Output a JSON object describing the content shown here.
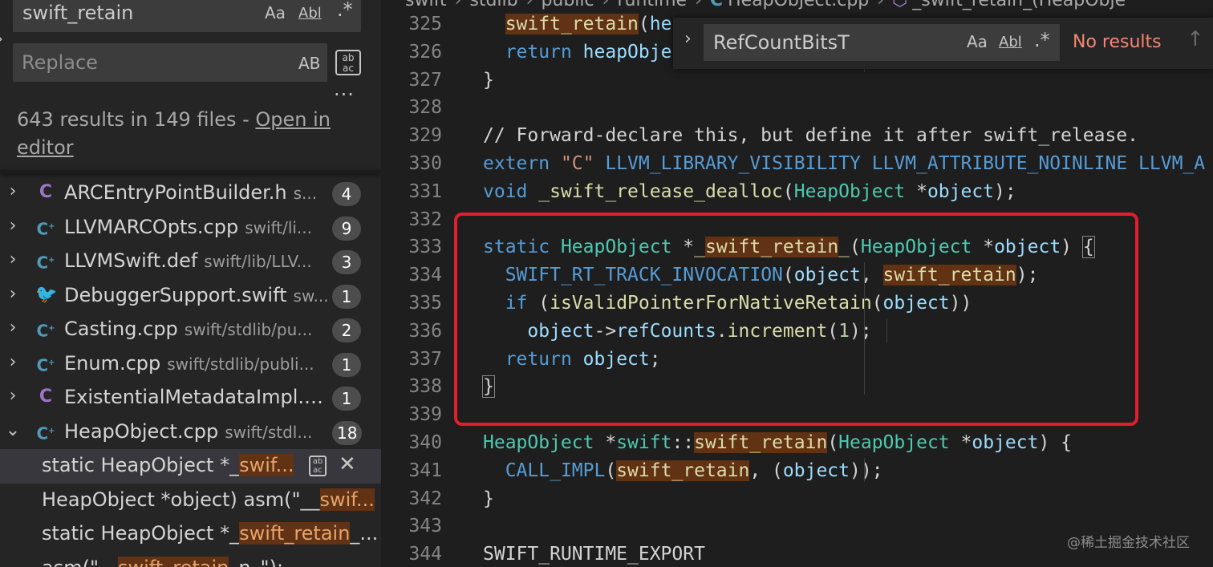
{
  "search": {
    "value": "swift_retain",
    "opt_case": "Aa",
    "opt_word": "Abl",
    "opt_regex": ".*"
  },
  "replace": {
    "placeholder": "Replace",
    "opt_preserve_case": "AB",
    "replace_all_label": "ab ac"
  },
  "results": {
    "summary": "643 results in 149 files - ",
    "open_in_editor": "Open in editor"
  },
  "files": [
    {
      "name": "ARCEntryPointBuilder.h",
      "path": "s...",
      "count": "4",
      "icon": "C",
      "icon_color": "#a074c4"
    },
    {
      "name": "LLVMARCOpts.cpp",
      "path": "swift/li...",
      "count": "9",
      "icon": "C+",
      "icon_color": "#519aba"
    },
    {
      "name": "LLVMSwift.def",
      "path": "swift/lib/LLV...",
      "count": "3",
      "icon": "C+",
      "icon_color": "#519aba"
    },
    {
      "name": "DebuggerSupport.swift",
      "path": "sw...",
      "count": "1",
      "icon": "swift",
      "icon_color": "#e37933"
    },
    {
      "name": "Casting.cpp",
      "path": "swift/stdlib/pu...",
      "count": "2",
      "icon": "C+",
      "icon_color": "#519aba"
    },
    {
      "name": "Enum.cpp",
      "path": "swift/stdlib/publi...",
      "count": "1",
      "icon": "C+",
      "icon_color": "#519aba"
    },
    {
      "name": "ExistentialMetadataImpl.h...",
      "path": "",
      "count": "1",
      "icon": "C",
      "icon_color": "#a074c4"
    },
    {
      "name": "HeapObject.cpp",
      "path": "swift/stdl...",
      "count": "18",
      "icon": "C+",
      "icon_color": "#519aba"
    }
  ],
  "matches": [
    {
      "pre": "static HeapObject *_",
      "hit": "swif...",
      "post": ""
    },
    {
      "pre": "HeapObject *object) asm(\"__",
      "hit": "swif...",
      "post": ""
    },
    {
      "pre": "static HeapObject *_",
      "hit": "swift_retain",
      "post": "_..."
    },
    {
      "pre": "asm(\"__",
      "hit": "swift_retain",
      "post": "_n_\");"
    }
  ],
  "breadcrumb": {
    "items": [
      "swift",
      "stdlib",
      "public",
      "runtime",
      "HeapObject.cpp",
      "_swift_retain_(HeapObje"
    ]
  },
  "find": {
    "value": "RefCountBitsT",
    "opt_case": "Aa",
    "opt_word": "Abl",
    "opt_regex": ".*",
    "status": "No results"
  },
  "lines": [
    "325",
    "326",
    "327",
    "328",
    "329",
    "330",
    "331",
    "332",
    "333",
    "334",
    "335",
    "336",
    "337",
    "338",
    "339",
    "340",
    "341",
    "342",
    "343",
    "344"
  ],
  "code": {
    "l329": "// Forward-declare this, but define it after swift_release.",
    "l330_kw": "extern",
    "l330_str": "\"C\"",
    "l330_rest": "LLVM_LIBRARY_VISIBILITY LLVM_ATTRIBUTE_NOINLINE LLVM_A",
    "l331_fn": "_swift_release_dealloc",
    "l344": "SWIFT_RUNTIME_EXPORT"
  },
  "watermark": "@稀土掘金技术社区",
  "colors": {
    "highlight_border": "#e01e2d",
    "match_bg": "#613214",
    "no_results": "#f48771"
  }
}
